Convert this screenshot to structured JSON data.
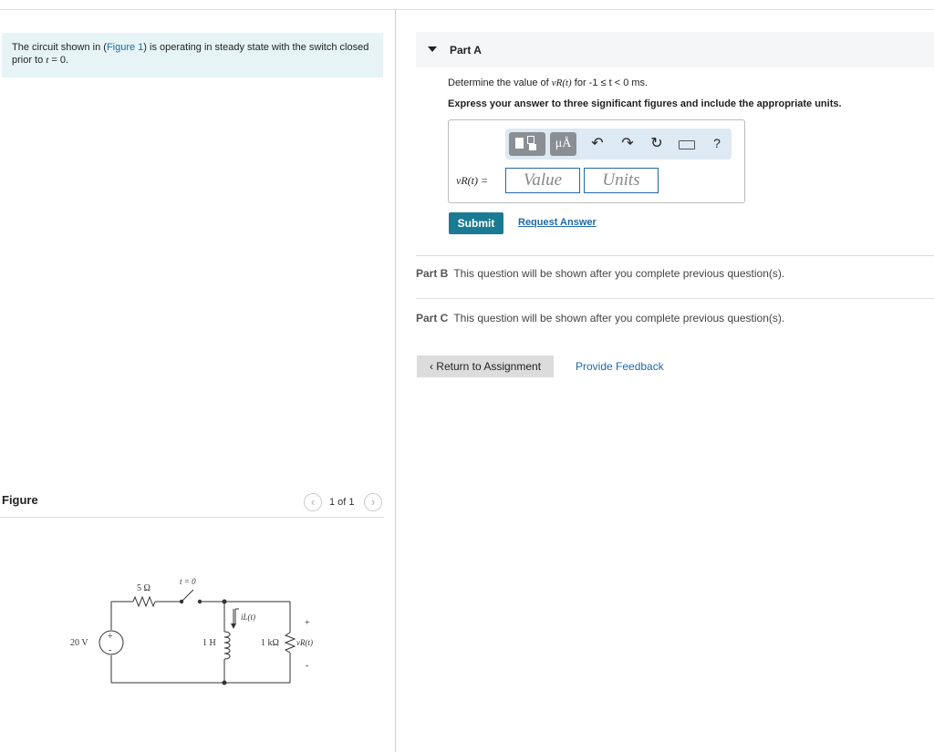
{
  "problem": {
    "text_before": "The circuit shown in (",
    "figure_link": "Figure 1",
    "text_middle": ") is operating in steady state with the switch closed prior to ",
    "t_symbol": "t",
    "text_after": " = 0."
  },
  "figure": {
    "label": "Figure",
    "counter": "1 of 1",
    "circuit": {
      "source_label": "20 V",
      "resistor1_label": "5 Ω",
      "switch_label": "t = 0",
      "inductor_label": "1 H",
      "inductor_current_label": "iL(t)",
      "resistor2_label": "1 kΩ",
      "voltage_label": "vR(t)",
      "plus": "+",
      "minus": "-"
    }
  },
  "partA": {
    "title": "Part A",
    "question_prefix": "Determine the value of ",
    "question_var": "vR(t)",
    "question_suffix": " for -1 ≤ t < 0 ms.",
    "instructions": "Express your answer to three significant figures and include the appropriate units.",
    "answer_label": "vR(t) =",
    "value_placeholder": "Value",
    "units_placeholder": "Units",
    "toolbar": {
      "unit_button": "μÅ",
      "help": "?"
    },
    "submit_label": "Submit",
    "request_answer_label": "Request Answer"
  },
  "partB": {
    "label": "Part B",
    "text": "This question will be shown after you complete previous question(s)."
  },
  "partC": {
    "label": "Part C",
    "text": "This question will be shown after you complete previous question(s)."
  },
  "footer": {
    "return_label": "Return to Assignment",
    "feedback_label": "Provide Feedback"
  }
}
